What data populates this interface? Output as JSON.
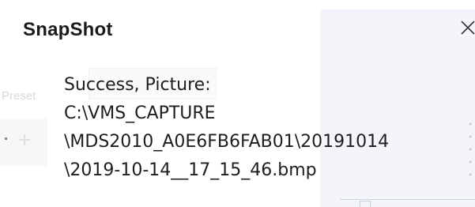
{
  "background": {
    "preset_label": "Preset"
  },
  "dialog": {
    "title": "SnapShot",
    "close_icon": "close-icon",
    "message_lines": [
      "Success, Picture:",
      "C:\\VMS_CAPTURE",
      "\\MDS2010_A0E6FB6FAB01\\20191014",
      "\\2019-10-14__17_15_46.bmp"
    ]
  },
  "colors": {
    "text": "#1e1e1e",
    "title": "#1b1b1b",
    "backdrop_panel": "#e9edf5"
  }
}
